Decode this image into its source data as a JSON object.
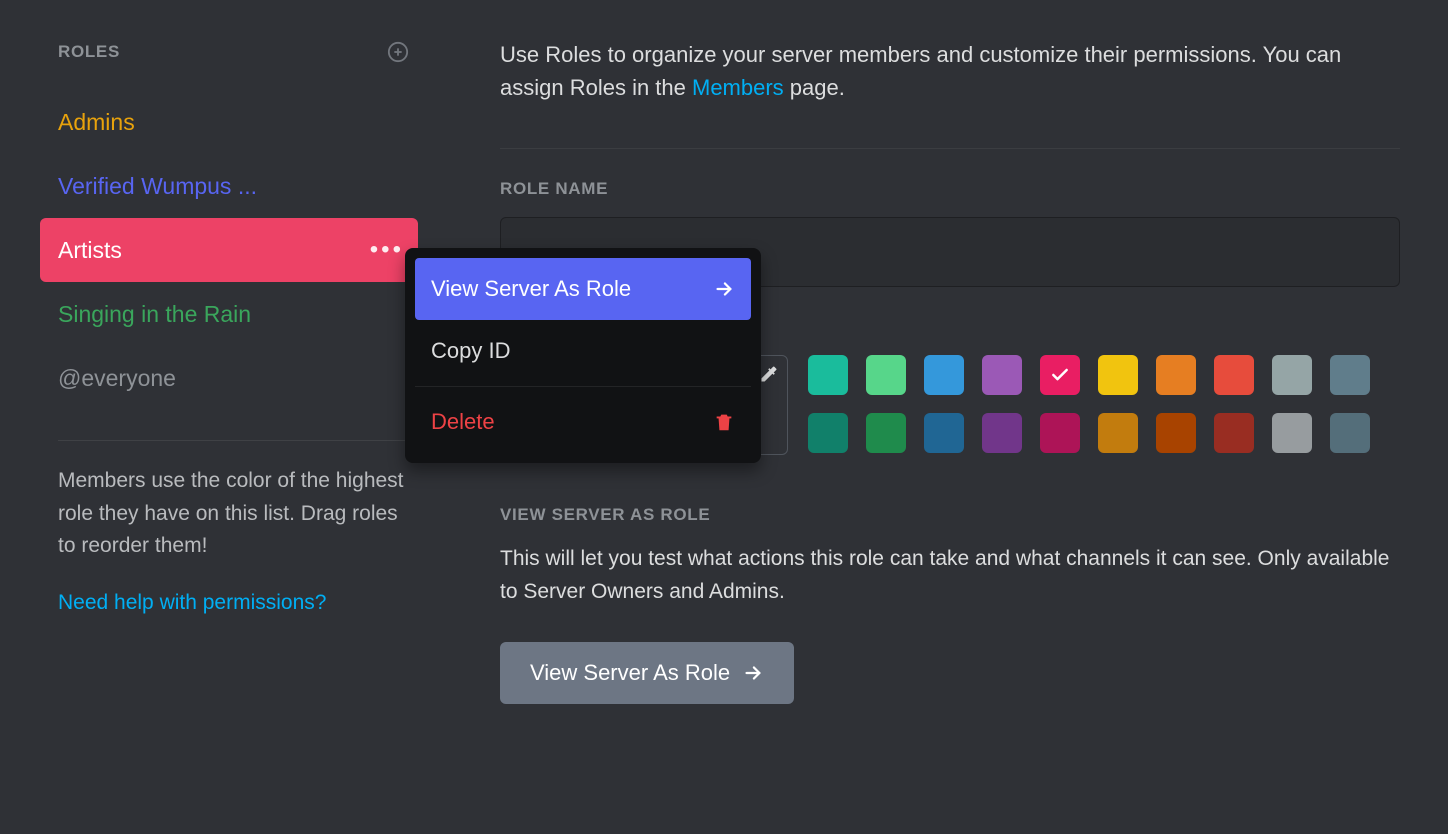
{
  "sidebar": {
    "header": "Roles",
    "roles": [
      {
        "label": "Admins",
        "color": "#e8a20c"
      },
      {
        "label": "Verified Wumpus ...",
        "color": "#5865f2"
      },
      {
        "label": "Artists",
        "color": "#ffffff",
        "selected": true
      },
      {
        "label": "Singing in the Rain",
        "color": "#3aa65c"
      },
      {
        "label": "@everyone",
        "color": "#8e9297"
      }
    ],
    "help_text": "Members use the color of the highest role they have on this list. Drag roles to reorder them!",
    "help_link": "Need help with permissions?"
  },
  "context_menu": {
    "view_as_role": "View Server As Role",
    "copy_id": "Copy ID",
    "delete": "Delete"
  },
  "main": {
    "intro_prefix": "Use Roles to organize your server members and customize their permissions. You can assign Roles in the ",
    "intro_link": "Members",
    "intro_suffix": " page.",
    "role_name_label": "Role Name",
    "colors_row1": [
      "#1abc9c",
      "#57d68a",
      "#3498db",
      "#9b59b6",
      "#e91e63",
      "#f1c40f",
      "#e67e22",
      "#e74c3c",
      "#95a5a6",
      "#607d8b"
    ],
    "colors_row2": [
      "#11806a",
      "#1f8b4c",
      "#206694",
      "#71368a",
      "#ad1457",
      "#c27c0e",
      "#a84300",
      "#992d22",
      "#979c9f",
      "#546e7a"
    ],
    "selected_color_index": 4,
    "view_section": {
      "label": "View Server As Role",
      "desc": "This will let you test what actions this role can take and what channels it can see. Only available to Server Owners and Admins.",
      "button": "View Server As Role"
    }
  }
}
